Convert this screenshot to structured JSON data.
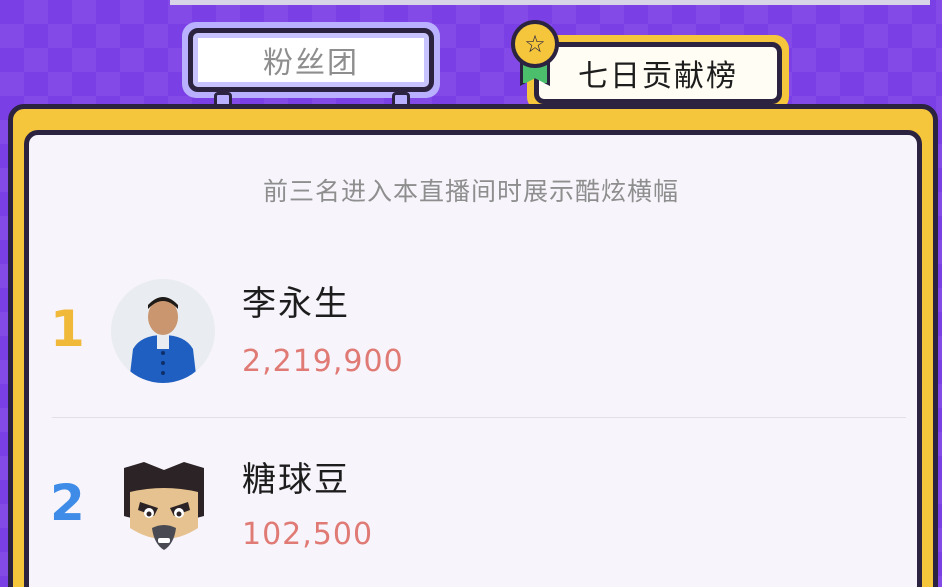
{
  "tabs": {
    "fans_label": "粉丝团",
    "rank_label": "七日贡献榜"
  },
  "board": {
    "subtitle": "前三名进入本直播间时展示酷炫横幅",
    "entries": [
      {
        "rank": "1",
        "name": "李永生",
        "score": "2,219,900"
      },
      {
        "rank": "2",
        "name": "糖球豆",
        "score": "102,500"
      }
    ]
  },
  "icons": {
    "badge": "star-icon"
  },
  "colors": {
    "background": "#7b3fe6",
    "board_yellow": "#f5c63b",
    "rank1": "#f0b93a",
    "rank2": "#3f8ce8",
    "score": "#e07a74"
  }
}
